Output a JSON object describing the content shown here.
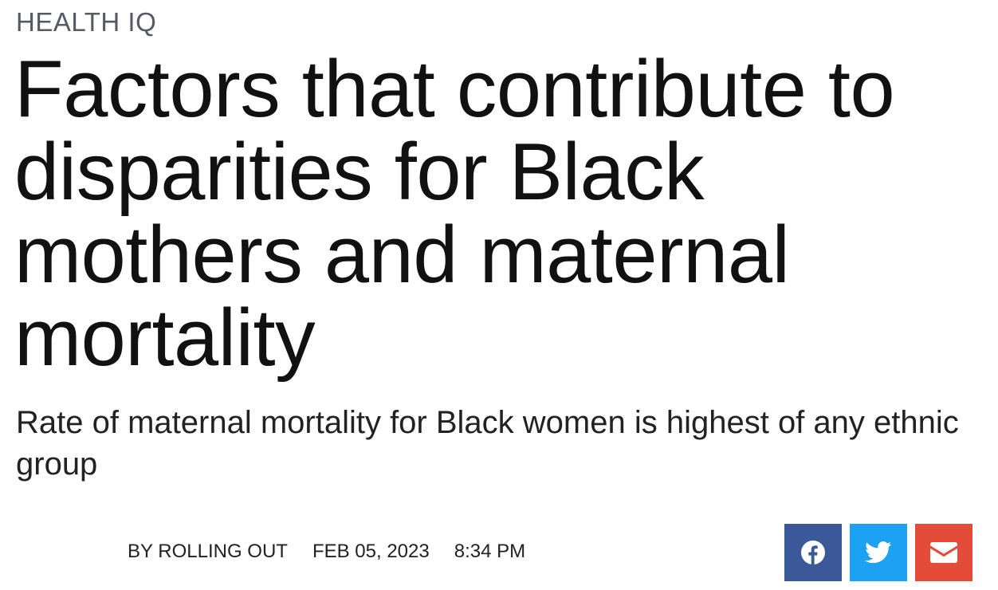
{
  "article": {
    "category": "HEALTH IQ",
    "title": "Factors that contribute to disparities for Black mothers and maternal mortality",
    "subtitle": "Rate of maternal mortality for Black women is highest of any ethnic group",
    "byline": "BY ROLLING OUT",
    "date": "FEB 05, 2023",
    "time": "8:34 PM"
  },
  "share": {
    "buttons": [
      {
        "icon": "facebook-icon",
        "color": "#3b5998"
      },
      {
        "icon": "twitter-icon",
        "color": "#1da1f2"
      },
      {
        "icon": "email-icon",
        "color": "#e44b38"
      }
    ]
  }
}
